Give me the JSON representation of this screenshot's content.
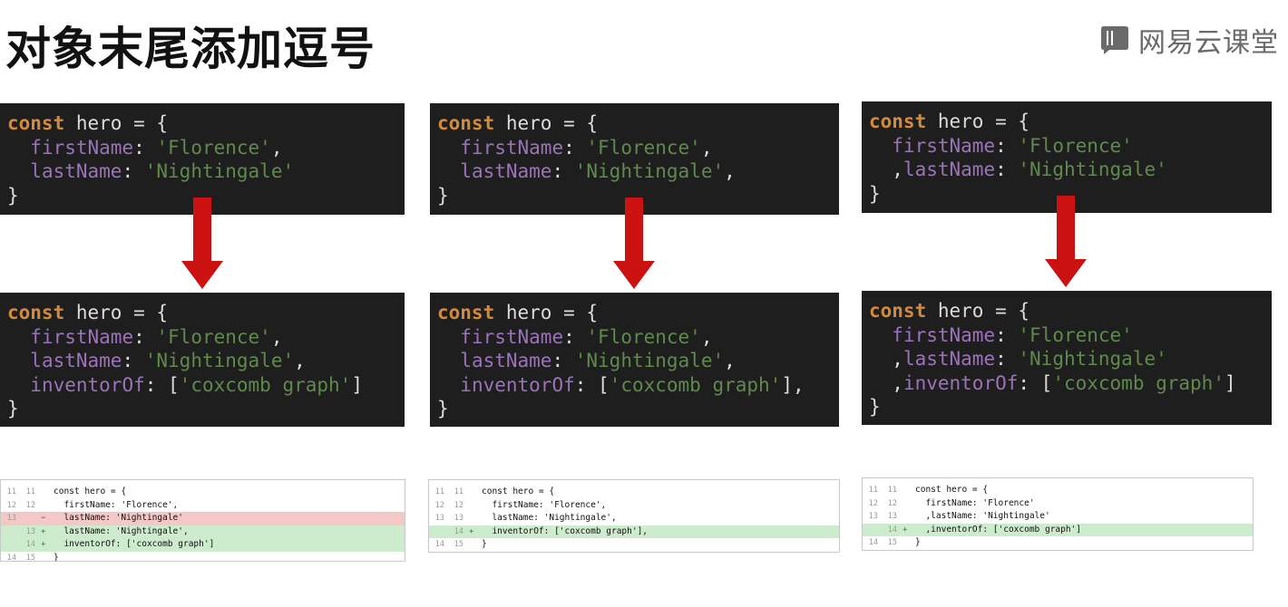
{
  "slide": {
    "title": "对象末尾添加逗号",
    "brand": "网易云课堂",
    "brand_icon": "book-icon"
  },
  "colors": {
    "code_bg": "#1e1e1e",
    "keyword": "#d28a3c",
    "property": "#9b73b8",
    "string": "#5f8a4c",
    "arrow": "#cc1111",
    "diff_added": "#cdeccd",
    "diff_removed": "#f5c8c8"
  },
  "top_blocks": [
    {
      "lines": [
        [
          {
            "t": "kw",
            "v": "const"
          },
          {
            "t": "pun",
            "v": " hero = {"
          }
        ],
        [
          {
            "t": "pun",
            "v": "  "
          },
          {
            "t": "prop",
            "v": "firstName"
          },
          {
            "t": "pun",
            "v": ": "
          },
          {
            "t": "str",
            "v": "'Florence'"
          },
          {
            "t": "pun",
            "v": ","
          }
        ],
        [
          {
            "t": "pun",
            "v": "  "
          },
          {
            "t": "prop",
            "v": "lastName"
          },
          {
            "t": "pun",
            "v": ": "
          },
          {
            "t": "str",
            "v": "'Nightingale'"
          }
        ],
        [
          {
            "t": "pun",
            "v": "}"
          }
        ]
      ]
    },
    {
      "lines": [
        [
          {
            "t": "kw",
            "v": "const"
          },
          {
            "t": "pun",
            "v": " hero = {"
          }
        ],
        [
          {
            "t": "pun",
            "v": "  "
          },
          {
            "t": "prop",
            "v": "firstName"
          },
          {
            "t": "pun",
            "v": ": "
          },
          {
            "t": "str",
            "v": "'Florence'"
          },
          {
            "t": "pun",
            "v": ","
          }
        ],
        [
          {
            "t": "pun",
            "v": "  "
          },
          {
            "t": "prop",
            "v": "lastName"
          },
          {
            "t": "pun",
            "v": ": "
          },
          {
            "t": "str",
            "v": "'Nightingale'"
          },
          {
            "t": "pun",
            "v": ","
          }
        ],
        [
          {
            "t": "pun",
            "v": "}"
          }
        ]
      ]
    },
    {
      "lines": [
        [
          {
            "t": "kw",
            "v": "const"
          },
          {
            "t": "pun",
            "v": " hero = {"
          }
        ],
        [
          {
            "t": "pun",
            "v": "  "
          },
          {
            "t": "prop",
            "v": "firstName"
          },
          {
            "t": "pun",
            "v": ": "
          },
          {
            "t": "str",
            "v": "'Florence'"
          }
        ],
        [
          {
            "t": "pun",
            "v": "  ,"
          },
          {
            "t": "prop",
            "v": "lastName"
          },
          {
            "t": "pun",
            "v": ": "
          },
          {
            "t": "str",
            "v": "'Nightingale'"
          }
        ],
        [
          {
            "t": "pun",
            "v": "}"
          }
        ]
      ]
    }
  ],
  "bottom_blocks": [
    {
      "lines": [
        [
          {
            "t": "kw",
            "v": "const"
          },
          {
            "t": "pun",
            "v": " hero = {"
          }
        ],
        [
          {
            "t": "pun",
            "v": "  "
          },
          {
            "t": "prop",
            "v": "firstName"
          },
          {
            "t": "pun",
            "v": ": "
          },
          {
            "t": "str",
            "v": "'Florence'"
          },
          {
            "t": "pun",
            "v": ","
          }
        ],
        [
          {
            "t": "pun",
            "v": "  "
          },
          {
            "t": "prop",
            "v": "lastName"
          },
          {
            "t": "pun",
            "v": ": "
          },
          {
            "t": "str",
            "v": "'Nightingale'"
          },
          {
            "t": "pun",
            "v": ","
          }
        ],
        [
          {
            "t": "pun",
            "v": "  "
          },
          {
            "t": "prop",
            "v": "inventorOf"
          },
          {
            "t": "pun",
            "v": ": ["
          },
          {
            "t": "str",
            "v": "'coxcomb graph'"
          },
          {
            "t": "pun",
            "v": "]"
          }
        ],
        [
          {
            "t": "pun",
            "v": "}"
          }
        ]
      ]
    },
    {
      "lines": [
        [
          {
            "t": "kw",
            "v": "const"
          },
          {
            "t": "pun",
            "v": " hero = {"
          }
        ],
        [
          {
            "t": "pun",
            "v": "  "
          },
          {
            "t": "prop",
            "v": "firstName"
          },
          {
            "t": "pun",
            "v": ": "
          },
          {
            "t": "str",
            "v": "'Florence'"
          },
          {
            "t": "pun",
            "v": ","
          }
        ],
        [
          {
            "t": "pun",
            "v": "  "
          },
          {
            "t": "prop",
            "v": "lastName"
          },
          {
            "t": "pun",
            "v": ": "
          },
          {
            "t": "str",
            "v": "'Nightingale'"
          },
          {
            "t": "pun",
            "v": ","
          }
        ],
        [
          {
            "t": "pun",
            "v": "  "
          },
          {
            "t": "prop",
            "v": "inventorOf"
          },
          {
            "t": "pun",
            "v": ": ["
          },
          {
            "t": "str",
            "v": "'coxcomb graph'"
          },
          {
            "t": "pun",
            "v": "],"
          }
        ],
        [
          {
            "t": "pun",
            "v": "}"
          }
        ]
      ]
    },
    {
      "lines": [
        [
          {
            "t": "kw",
            "v": "const"
          },
          {
            "t": "pun",
            "v": " hero = {"
          }
        ],
        [
          {
            "t": "pun",
            "v": "  "
          },
          {
            "t": "prop",
            "v": "firstName"
          },
          {
            "t": "pun",
            "v": ": "
          },
          {
            "t": "str",
            "v": "'Florence'"
          }
        ],
        [
          {
            "t": "pun",
            "v": "  ,"
          },
          {
            "t": "prop",
            "v": "lastName"
          },
          {
            "t": "pun",
            "v": ": "
          },
          {
            "t": "str",
            "v": "'Nightingale'"
          }
        ],
        [
          {
            "t": "pun",
            "v": "  ,"
          },
          {
            "t": "prop",
            "v": "inventorOf"
          },
          {
            "t": "pun",
            "v": ": ["
          },
          {
            "t": "str",
            "v": "'coxcomb graph'"
          },
          {
            "t": "pun",
            "v": "]"
          }
        ],
        [
          {
            "t": "pun",
            "v": "}"
          }
        ]
      ]
    }
  ],
  "diffs": [
    {
      "rows": [
        {
          "old": "11",
          "new": "11",
          "type": "ctx",
          "text": "const hero = {"
        },
        {
          "old": "12",
          "new": "12",
          "type": "ctx",
          "text": "  firstName: 'Florence',"
        },
        {
          "old": "13",
          "new": "",
          "type": "del",
          "text": "  lastName: 'Nightingale'"
        },
        {
          "old": "",
          "new": "13",
          "type": "add",
          "text": "  lastName: 'Nightingale',"
        },
        {
          "old": "",
          "new": "14",
          "type": "add",
          "text": "  inventorOf: ['coxcomb graph']"
        },
        {
          "old": "14",
          "new": "15",
          "type": "ctx",
          "text": "}"
        }
      ]
    },
    {
      "rows": [
        {
          "old": "11",
          "new": "11",
          "type": "ctx",
          "text": "const hero = {"
        },
        {
          "old": "12",
          "new": "12",
          "type": "ctx",
          "text": "  firstName: 'Florence',"
        },
        {
          "old": "13",
          "new": "13",
          "type": "ctx",
          "text": "  lastName: 'Nightingale',"
        },
        {
          "old": "",
          "new": "14",
          "type": "add",
          "text": "  inventorOf: ['coxcomb graph'],"
        },
        {
          "old": "14",
          "new": "15",
          "type": "ctx",
          "text": "}"
        }
      ]
    },
    {
      "rows": [
        {
          "old": "11",
          "new": "11",
          "type": "ctx",
          "text": "const hero = {"
        },
        {
          "old": "12",
          "new": "12",
          "type": "ctx",
          "text": "  firstName: 'Florence'"
        },
        {
          "old": "13",
          "new": "13",
          "type": "ctx",
          "text": "  ,lastName: 'Nightingale'"
        },
        {
          "old": "",
          "new": "14",
          "type": "add",
          "text": "  ,inventorOf: ['coxcomb graph']"
        },
        {
          "old": "14",
          "new": "15",
          "type": "ctx",
          "text": "}"
        }
      ]
    }
  ]
}
